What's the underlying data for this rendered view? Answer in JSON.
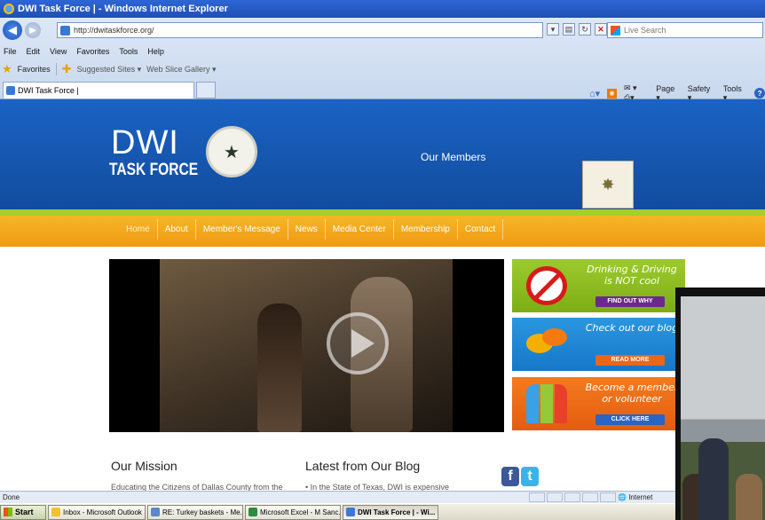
{
  "window": {
    "title": "DWI Task Force | - Windows Internet Explorer"
  },
  "toolbar": {
    "url": "http://dwitaskforce.org/",
    "search_placeholder": "Live Search",
    "menu": [
      "File",
      "Edit",
      "View",
      "Favorites",
      "Tools",
      "Help"
    ],
    "favorites_label": "Favorites",
    "suggested_sites": "Suggested Sites ▾",
    "web_slice": "Web Slice Gallery ▾",
    "tab_title": "DWI Task Force |",
    "commands": [
      "Page ▾",
      "Safety ▾",
      "Tools ▾"
    ]
  },
  "site": {
    "logo_line1": "DWI",
    "logo_line2": "TASK FORCE",
    "members_link": "Our Members",
    "nav": [
      "Home",
      "About",
      "Member's Message",
      "News",
      "Media Center",
      "Membership",
      "Contact"
    ],
    "promos": [
      {
        "title": "Drinking & Driving is NOT cool",
        "button": "FIND OUT WHY"
      },
      {
        "title": "Check out our blog",
        "button": "READ MORE"
      },
      {
        "title": "Become a member or volunteer",
        "button": "CLICK HERE"
      }
    ],
    "mission_title": "Our Mission",
    "mission_text": "Educating the Citizens of Dallas County from the",
    "blog_title": "Latest from Our Blog",
    "blog_text": "• In the State of Texas, DWI is expensive"
  },
  "status": {
    "text": "Done",
    "zone": "Internet"
  },
  "taskbar": {
    "start": "Start",
    "items": [
      "Inbox - Microsoft Outlook",
      "RE: Turkey baskets - Me...",
      "Microsoft Excel - M Sanc...",
      "DWI Task Force | - Wi..."
    ]
  }
}
